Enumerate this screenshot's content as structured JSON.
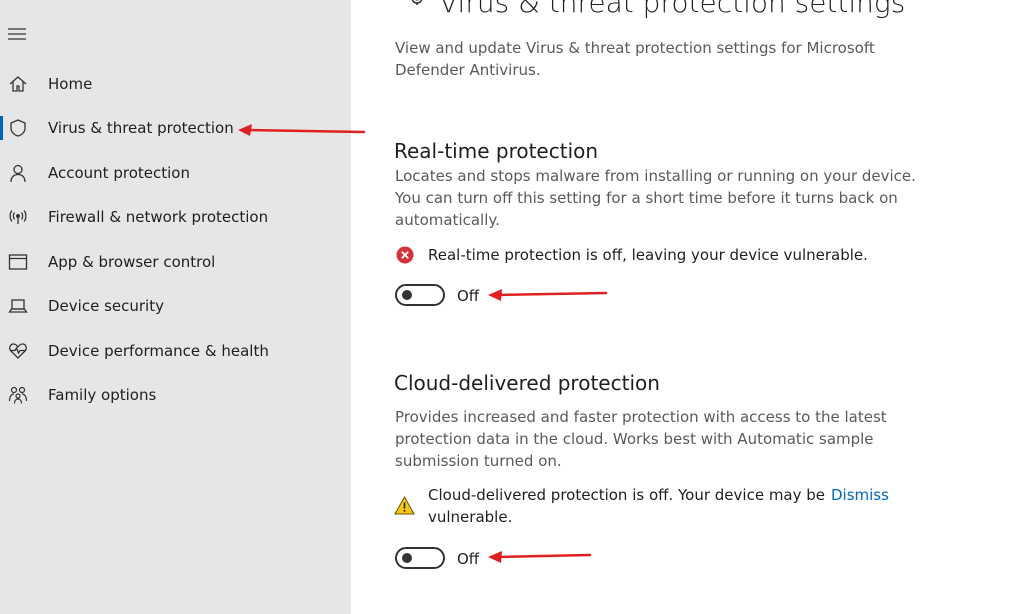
{
  "sidebar": {
    "menu_icon": "hamburger-icon",
    "items": [
      {
        "label": "Home",
        "icon": "home-icon",
        "active": false
      },
      {
        "label": "Virus & threat protection",
        "icon": "shield-icon",
        "active": true
      },
      {
        "label": "Account protection",
        "icon": "person-icon",
        "active": false
      },
      {
        "label": "Firewall & network protection",
        "icon": "wifi-signal-icon",
        "active": false
      },
      {
        "label": "App & browser control",
        "icon": "browser-window-icon",
        "active": false
      },
      {
        "label": "Device security",
        "icon": "laptop-icon",
        "active": false
      },
      {
        "label": "Device performance & health",
        "icon": "heart-pulse-icon",
        "active": false
      },
      {
        "label": "Family options",
        "icon": "family-icon",
        "active": false
      }
    ]
  },
  "main": {
    "title": "Virus & threat protection settings",
    "title_icon": "gear-shield-icon",
    "description": "View and update Virus & threat protection settings for Microsoft Defender Antivirus.",
    "realtime": {
      "title": "Real-time protection",
      "description": "Locates and stops malware from installing or running on your device. You can turn off this setting for a short time before it turns back on automatically.",
      "status_icon": "error-x-icon",
      "status": "Real-time protection is off, leaving your device vulnerable.",
      "toggle_state": "Off"
    },
    "cloud": {
      "title": "Cloud-delivered protection",
      "description": "Provides increased and faster protection with access to the latest protection data in the cloud. Works best with Automatic sample submission turned on.",
      "status_icon": "warning-triangle-icon",
      "status": "Cloud-delivered protection is off. Your device may be vulnerable.",
      "dismiss_label": "Dismiss",
      "toggle_state": "Off"
    }
  },
  "colors": {
    "sidebar_bg": "#e6e6e6",
    "accent": "#0067c0",
    "error": "#d13438",
    "warning": "#f5c518",
    "annotation_arrow": "#e02020"
  }
}
